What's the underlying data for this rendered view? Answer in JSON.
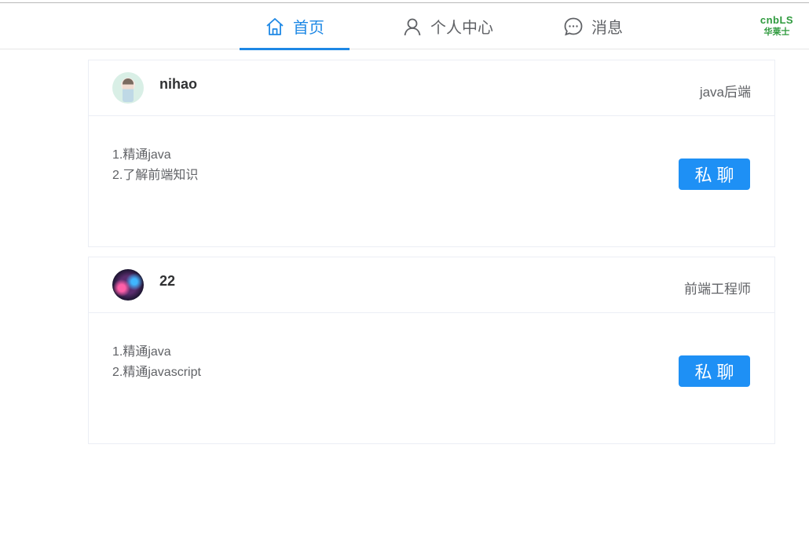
{
  "nav": {
    "items": [
      {
        "label": "首页",
        "icon": "home-icon",
        "active": true
      },
      {
        "label": "个人中心",
        "icon": "user-icon",
        "active": false
      },
      {
        "label": "消息",
        "icon": "chat-bubble-icon",
        "active": false
      }
    ],
    "logo": {
      "line1": "cnbLS",
      "line2": "华莱士"
    }
  },
  "cards": [
    {
      "username": "nihao",
      "job": "java后端",
      "skills": [
        "1.精通java",
        "2.了解前端知识"
      ],
      "button_label": "私聊"
    },
    {
      "username": "22",
      "job": "前端工程师",
      "skills": [
        "1.精通java",
        "2.精通javascript"
      ],
      "button_label": "私聊"
    }
  ],
  "colors": {
    "accent": "#1e88e5",
    "button": "#1e90f5",
    "logo_green": "#2e9a3d",
    "text_muted": "#606266"
  }
}
